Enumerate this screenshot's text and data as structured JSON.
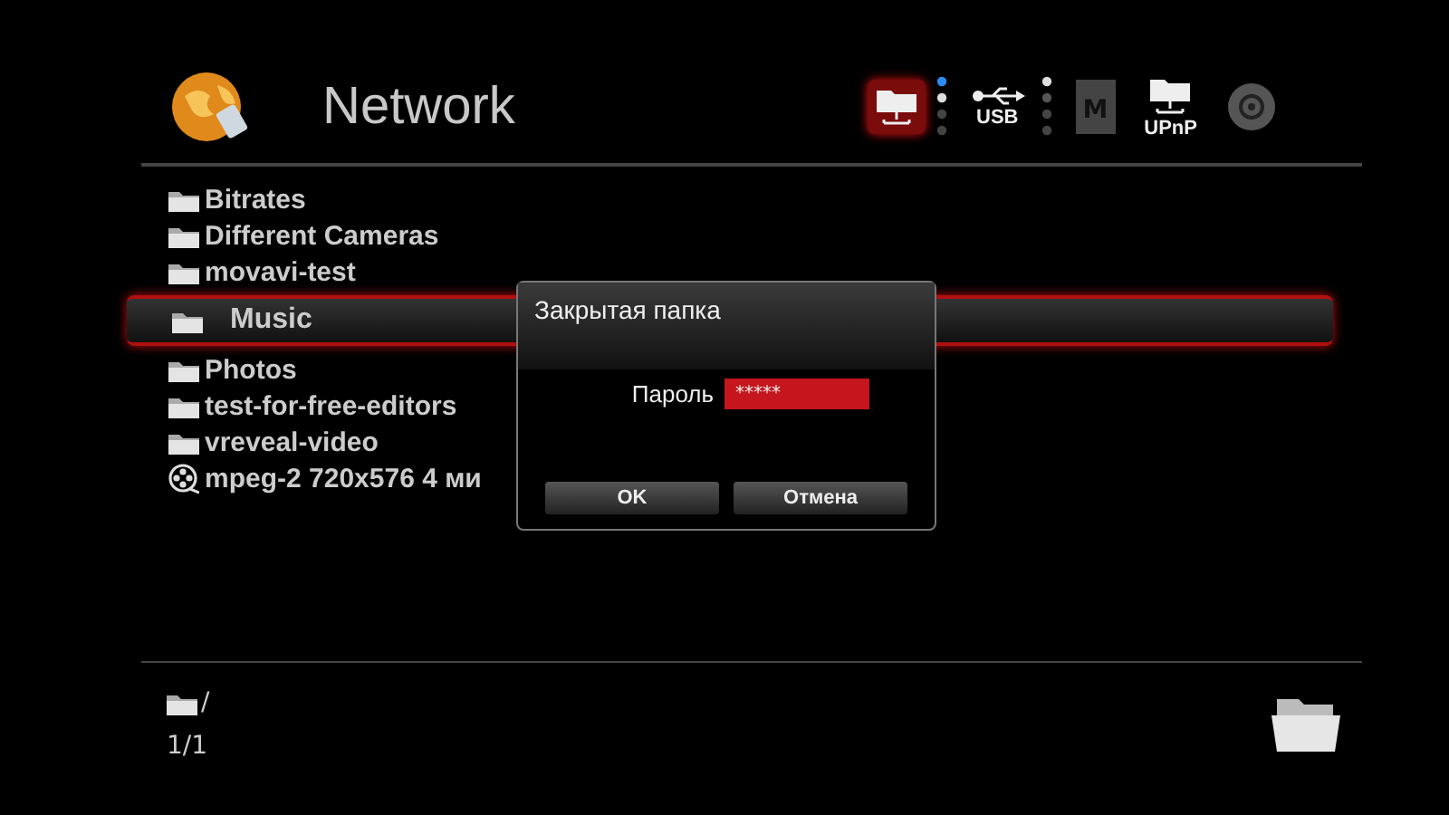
{
  "header": {
    "title": "Network"
  },
  "sources": [
    {
      "kind": "network",
      "selected": true
    },
    {
      "kind": "usb",
      "label": "USB",
      "selected": false
    },
    {
      "kind": "card",
      "label": "M",
      "selected": false
    },
    {
      "kind": "upnp",
      "label": "UPnP",
      "selected": false
    },
    {
      "kind": "disc",
      "selected": false
    }
  ],
  "items": [
    {
      "kind": "folder",
      "name": "Bitrates",
      "selected": false
    },
    {
      "kind": "folder",
      "name": "Different Cameras",
      "selected": false
    },
    {
      "kind": "folder",
      "name": "movavi-test",
      "selected": false
    },
    {
      "kind": "folder",
      "name": "Music",
      "selected": true
    },
    {
      "kind": "folder",
      "name": "Photos",
      "selected": false
    },
    {
      "kind": "folder",
      "name": "test-for-free-editors",
      "selected": false
    },
    {
      "kind": "folder",
      "name": "vreveal-video",
      "selected": false
    },
    {
      "kind": "video",
      "name": "mpeg-2 720x576 4 ми",
      "selected": false
    }
  ],
  "footer": {
    "path": "/",
    "page": "1/1"
  },
  "dialog": {
    "title": "Закрытая папка",
    "field_label": "Пароль",
    "value": "*****",
    "buttons": [
      "OK",
      "Отмена"
    ]
  }
}
